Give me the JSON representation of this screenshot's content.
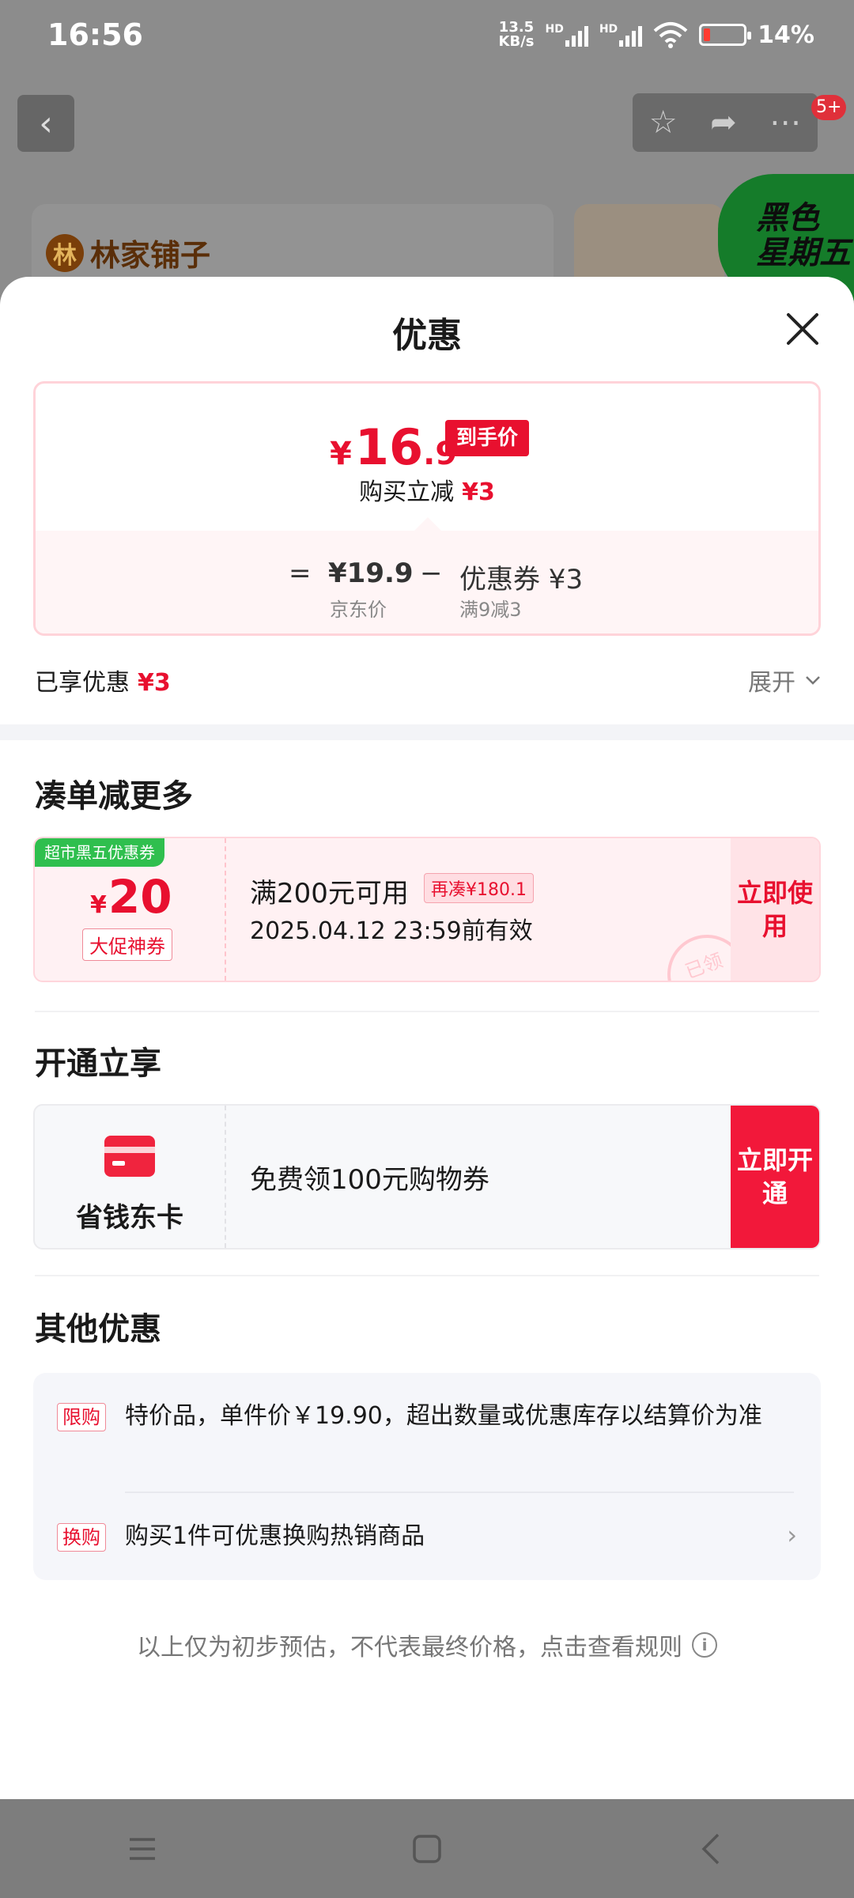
{
  "status_bar": {
    "time": "16:56",
    "net_speed_value": "13.5",
    "net_speed_unit": "KB/s",
    "signal_label_1": "HD",
    "signal_label_2": "HD",
    "battery": "14%"
  },
  "background": {
    "badge": "5+",
    "brand_logo": "林家铺子",
    "brand_seal": "林",
    "promo_line1": "黑色",
    "promo_line2": "星期五"
  },
  "sheet": {
    "title": "优惠",
    "price": {
      "currency": "¥",
      "integer": "16",
      "decimal": ".9",
      "tag": "到手价",
      "reduce_label": "购买立减",
      "reduce_amount": "¥3",
      "eq": "=",
      "base_price": "¥19.9",
      "base_label": "京东价",
      "minus": "−",
      "coupon": "优惠券 ¥3",
      "coupon_rule": "满9减3"
    },
    "enjoyed_label": "已享优惠",
    "enjoyed_amount": "¥3",
    "expand_label": "展开"
  },
  "section_more": {
    "title": "凑单减更多",
    "coupon": {
      "tag": "超市黑五优惠券",
      "currency": "¥",
      "amount": "20",
      "label": "大促神券",
      "condition": "满200元可用",
      "more": "再凑¥180.1",
      "expire": "2025.04.12 23:59前有效",
      "stamp": "已领",
      "button": "立即使用"
    }
  },
  "section_card": {
    "title": "开通立享",
    "card_name": "省钱东卡",
    "description": "免费领100元购物券",
    "button": "立即开通"
  },
  "section_other": {
    "title": "其他优惠",
    "offers": [
      {
        "tag": "限购",
        "text": "特价品，单件价￥19.90，超出数量或优惠库存以结算价为准"
      },
      {
        "tag": "换购",
        "text": "购买1件可优惠换购热销商品"
      }
    ]
  },
  "footnote": "以上仅为初步预估，不代表最终价格，点击查看规则",
  "colors": {
    "accent_red": "#e8102f",
    "coupon_green": "#2fbf4e"
  }
}
